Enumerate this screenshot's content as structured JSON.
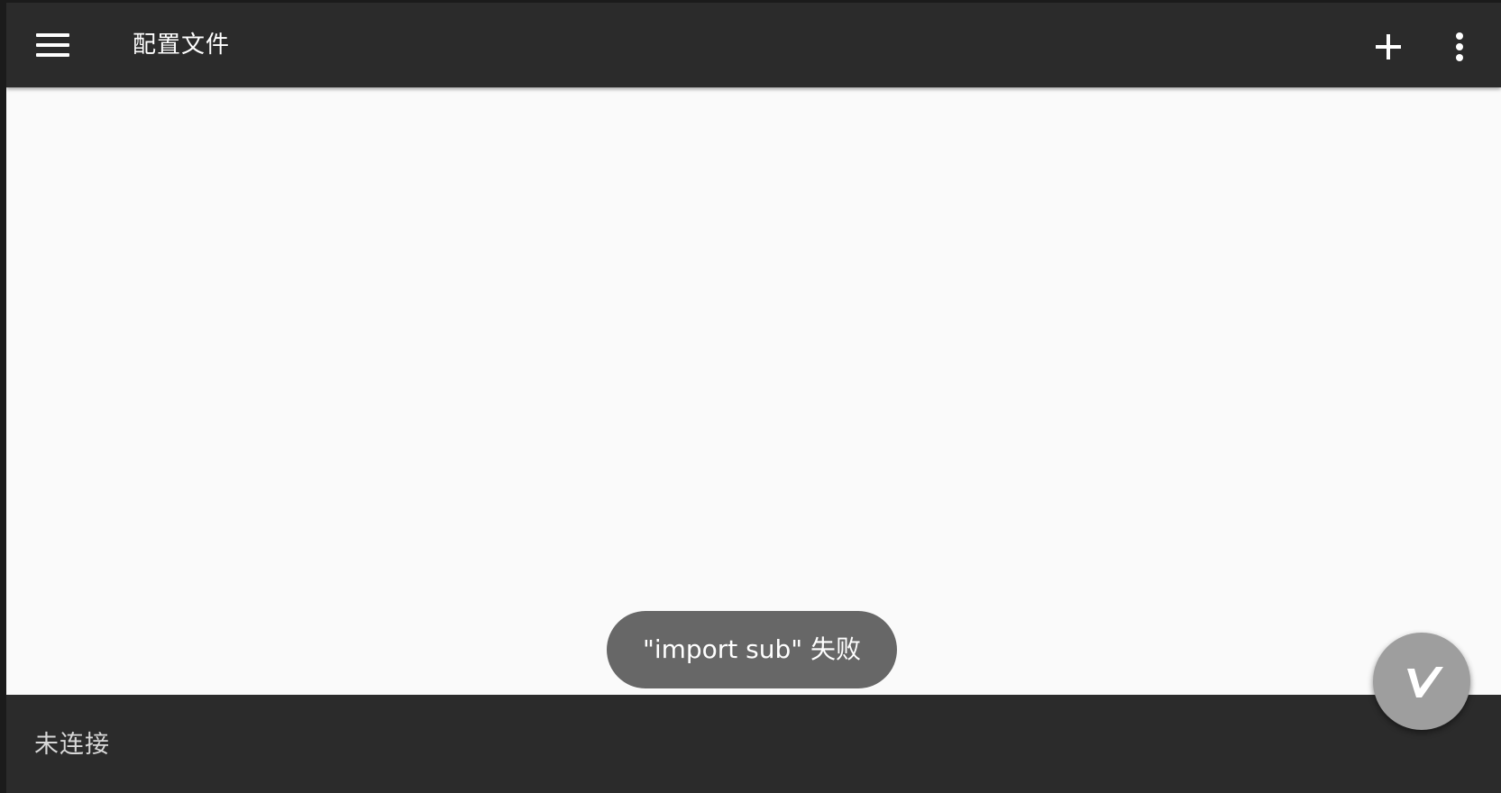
{
  "toolbar": {
    "title": "配置文件",
    "menu_icon": "hamburger-menu-icon",
    "add_icon": "plus-icon",
    "more_icon": "more-vert-icon"
  },
  "toast": {
    "message": "\"import sub\" 失败"
  },
  "status_bar": {
    "connection_status": "未连接"
  },
  "fab": {
    "icon": "v-logo-icon"
  },
  "colors": {
    "toolbar_bg": "#2b2b2b",
    "content_bg": "#fafafa",
    "toast_bg": "#676767",
    "fab_bg": "#9e9e9e"
  }
}
